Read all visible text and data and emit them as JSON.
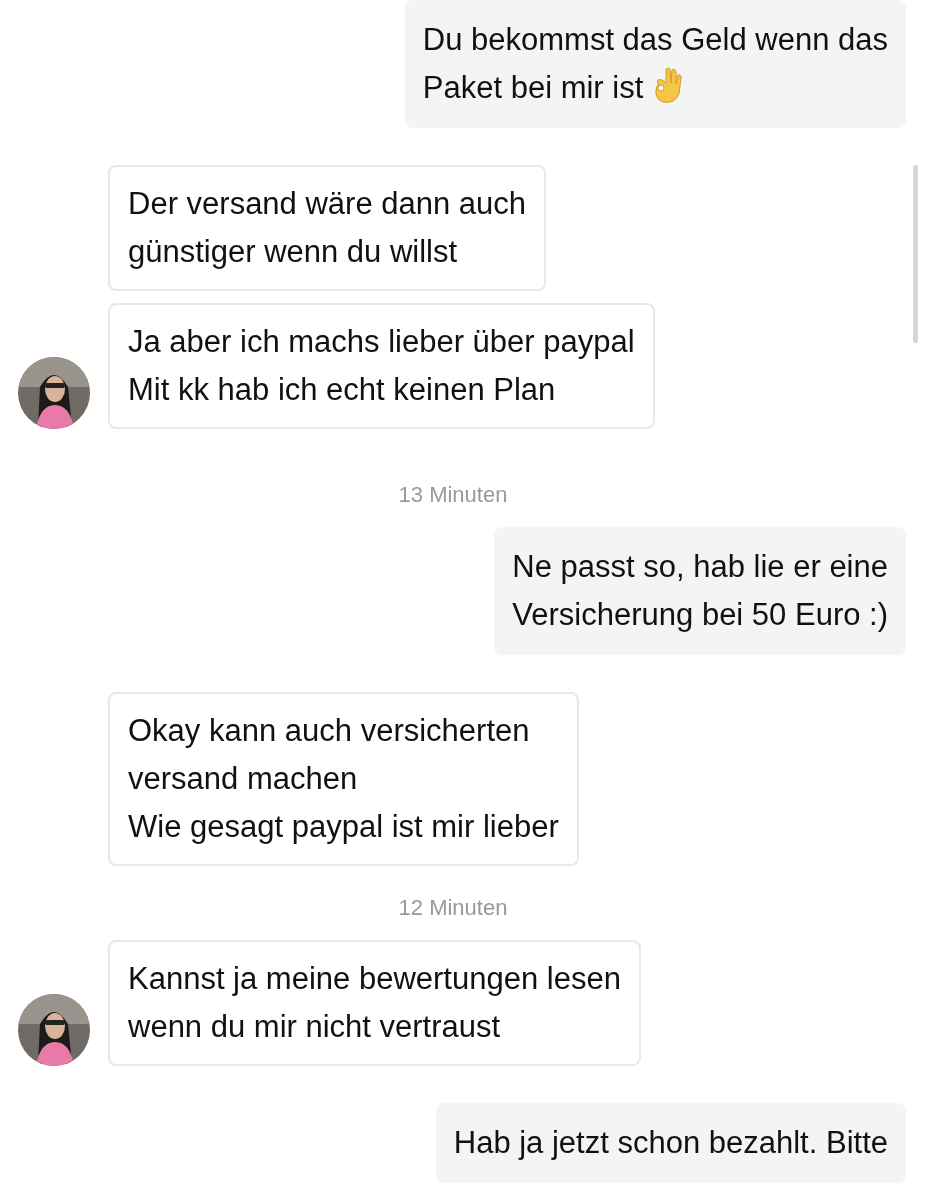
{
  "messages": [
    {
      "kind": "sent",
      "text": "Du bekommst das Geld wenn das\nPaket bei mir ist",
      "ok_hand": true
    },
    {
      "kind": "received",
      "text": "Der versand wäre dann auch\ngünstiger wenn du willst",
      "avatar": false
    },
    {
      "kind": "received",
      "text": "Ja aber ich machs lieber über paypal\nMit kk hab ich echt keinen Plan",
      "avatar": true
    },
    {
      "kind": "timestamp",
      "text": "13 Minuten"
    },
    {
      "kind": "sent",
      "text": "Ne passt so, hab lie er eine\nVersicherung bei 50 Euro :)",
      "ok_hand": false
    },
    {
      "kind": "received",
      "text": "Okay kann auch versicherten\nversand machen\nWie gesagt paypal ist mir lieber",
      "avatar": false
    },
    {
      "kind": "timestamp",
      "text": "12 Minuten"
    },
    {
      "kind": "received",
      "text": "Kannst ja meine bewertungen lesen\nwenn du mir nicht vertraust",
      "avatar": true
    },
    {
      "kind": "sent",
      "text": "Hab ja jetzt schon bezahlt. Bitte",
      "ok_hand": false
    }
  ]
}
